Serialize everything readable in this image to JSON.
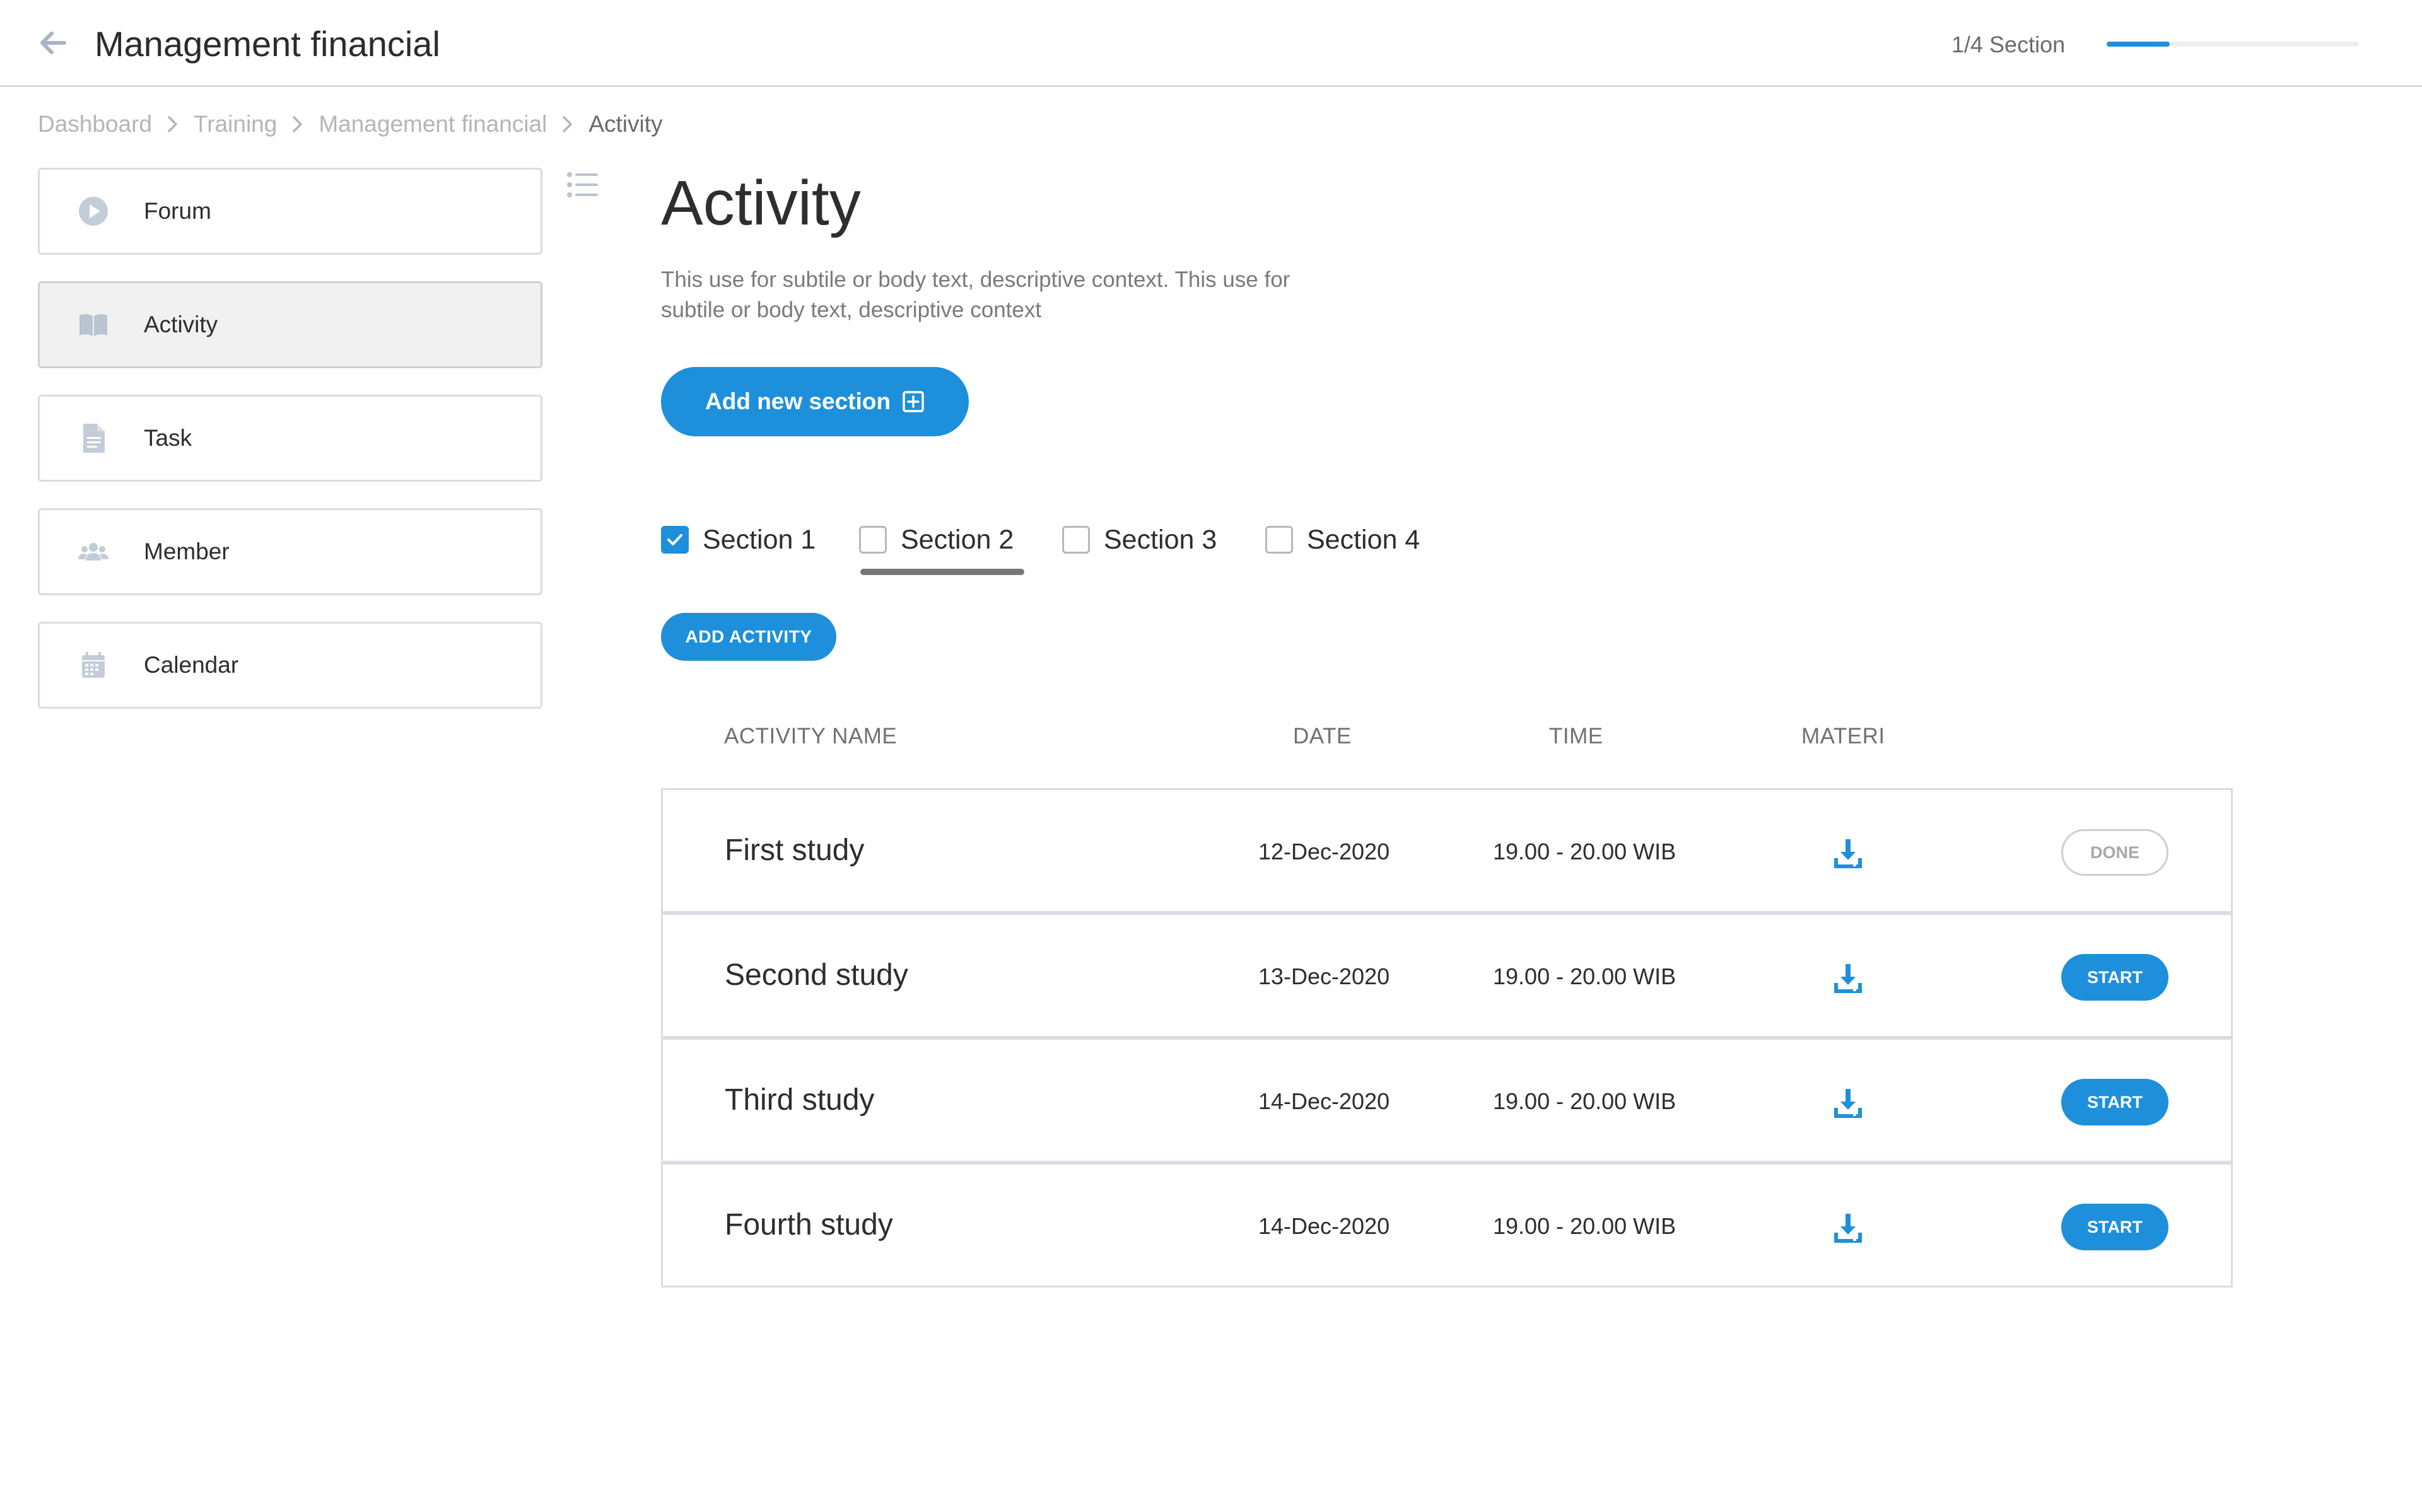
{
  "header": {
    "title": "Management financial",
    "back_icon": "arrow-left-icon",
    "progress_text": "1/4 Section",
    "progress_value": 0.25
  },
  "breadcrumb": [
    "Dashboard",
    "Training",
    "Management financial",
    "Activity"
  ],
  "sidebar": {
    "items": [
      {
        "label": "Forum",
        "icon": "play-circle-icon"
      },
      {
        "label": "Activity",
        "icon": "book-icon",
        "active": true
      },
      {
        "label": "Task",
        "icon": "document-icon"
      },
      {
        "label": "Member",
        "icon": "users-icon"
      },
      {
        "label": "Calendar",
        "icon": "calendar-icon"
      }
    ]
  },
  "main": {
    "title": "Activity",
    "description": "This use for subtile or body text, descriptive context. This use for subtile or body text, descriptive context",
    "add_section_label": "Add new section",
    "tabs": [
      {
        "label": "Section 1",
        "checked": true
      },
      {
        "label": "Section 2",
        "checked": false,
        "selected": true
      },
      {
        "label": "Section 3",
        "checked": false
      },
      {
        "label": "Section 4",
        "checked": false
      }
    ],
    "add_activity_label": "ADD ACTIVITY",
    "table": {
      "headers": [
        "ACTIVITY NAME",
        "DATE",
        "TIME",
        "MATERI"
      ],
      "rows": [
        {
          "name": "First study",
          "date": "12-Dec-2020",
          "time": "19.00 - 20.00 WIB",
          "action": "DONE"
        },
        {
          "name": "Second study",
          "date": "13-Dec-2020",
          "time": "19.00 - 20.00 WIB",
          "action": "START"
        },
        {
          "name": "Third study",
          "date": "14-Dec-2020",
          "time": "19.00 - 20.00 WIB",
          "action": "START"
        },
        {
          "name": "Fourth study",
          "date": "14-Dec-2020",
          "time": "19.00 - 20.00 WIB",
          "action": "START"
        }
      ]
    }
  },
  "colors": {
    "accent": "#1e90db",
    "border": "#d8dce3",
    "muted_text": "#b5b5b5",
    "icon_gray": "#b9c3d1"
  }
}
